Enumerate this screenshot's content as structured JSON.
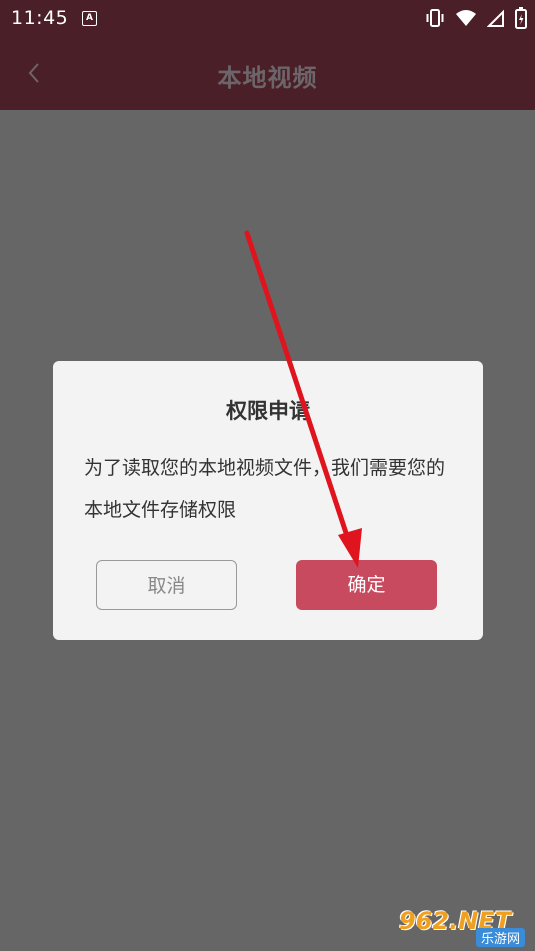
{
  "status_bar": {
    "time": "11:45",
    "notification_glyph": "A",
    "icons": [
      "vibrate-icon",
      "wifi-icon",
      "signal-icon",
      "battery-icon"
    ]
  },
  "app_bar": {
    "title": "本地视频",
    "back_icon": "chevron-left-icon"
  },
  "dialog": {
    "title": "权限申请",
    "message": "为了读取您的本地视频文件，我们需要您的本地文件存储权限",
    "cancel_label": "取消",
    "confirm_label": "确定"
  },
  "watermark": {
    "brand": "962.NET",
    "site": "乐游网"
  },
  "colors": {
    "app_bar_bg": "#4b1f27",
    "overlay_bg": "#666666",
    "dialog_bg": "#f3f3f3",
    "confirm_bg": "#c84a5e",
    "annotation_arrow": "#e0141e"
  }
}
